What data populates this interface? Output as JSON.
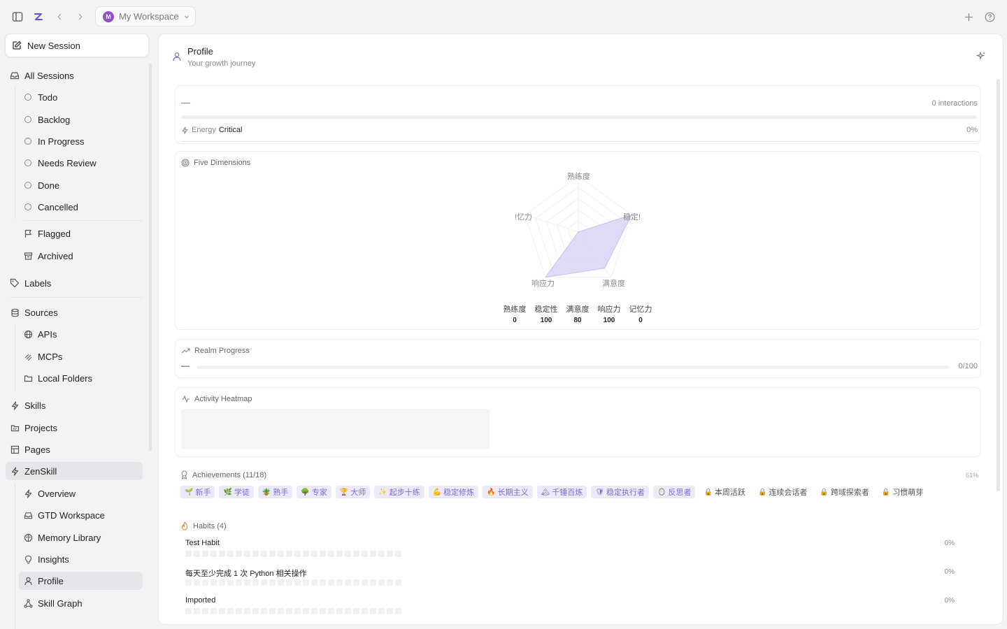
{
  "topbar": {
    "workspace_initial": "M",
    "workspace_name": "My Workspace"
  },
  "sidebar": {
    "new_session": "New Session",
    "all_sessions": "All Sessions",
    "statuses": [
      "Todo",
      "Backlog",
      "In Progress",
      "Needs Review",
      "Done",
      "Cancelled"
    ],
    "flagged": "Flagged",
    "archived": "Archived",
    "labels": "Labels",
    "sources": "Sources",
    "source_items": [
      "APIs",
      "MCPs",
      "Local Folders"
    ],
    "skills": "Skills",
    "projects": "Projects",
    "pages": "Pages",
    "zenskill": "ZenSkill",
    "zenskill_items": [
      "Overview",
      "GTD Workspace",
      "Memory Library",
      "Insights",
      "Profile",
      "Skill Graph"
    ]
  },
  "header": {
    "title": "Profile",
    "subtitle": "Your growth journey"
  },
  "level": {
    "name": "—",
    "interactions": "0 interactions",
    "energy_label": "Energy",
    "energy_value": "Critical",
    "energy_pct": "0%",
    "energy_fraction": 0
  },
  "dimensions": {
    "title": "Five Dimensions",
    "axes": [
      "熟练度",
      "稳定性",
      "满意度",
      "响应力",
      "记忆力"
    ],
    "axis_values": [
      0,
      100,
      80,
      100,
      0
    ],
    "axis_label_text": [
      "熟练度",
      "稳定!",
      "满意度",
      "响应力",
      "!忆力"
    ]
  },
  "realm": {
    "title": "Realm Progress",
    "name": "—",
    "value": "0/100",
    "fraction": 0
  },
  "heatmap": {
    "title": "Activity Heatmap"
  },
  "achievements": {
    "title": "Achievements (11/18)",
    "percent": "61%",
    "items": [
      {
        "icon": "🌱",
        "label": "新手",
        "unlocked": true
      },
      {
        "icon": "🌿",
        "label": "学徒",
        "unlocked": true
      },
      {
        "icon": "🪴",
        "label": "熟手",
        "unlocked": true
      },
      {
        "icon": "🌳",
        "label": "专家",
        "unlocked": true
      },
      {
        "icon": "🏆",
        "label": "大师",
        "unlocked": true
      },
      {
        "icon": "✨",
        "label": "起步十练",
        "unlocked": true
      },
      {
        "icon": "💪",
        "label": "稳定修炼",
        "unlocked": true
      },
      {
        "icon": "🔥",
        "label": "长期主义",
        "unlocked": true
      },
      {
        "icon": "🏔",
        "label": "千锤百炼",
        "unlocked": true
      },
      {
        "icon": "🛡",
        "label": "稳定执行者",
        "unlocked": true
      },
      {
        "icon": "🪞",
        "label": "反思者",
        "unlocked": true
      },
      {
        "icon": "🔒",
        "label": "本周活跃",
        "unlocked": false
      },
      {
        "icon": "🔒",
        "label": "连续会话者",
        "unlocked": false
      },
      {
        "icon": "🔒",
        "label": "跨域探索者",
        "unlocked": false
      },
      {
        "icon": "🔒",
        "label": "习惯萌芽",
        "unlocked": false
      }
    ]
  },
  "habits": {
    "title": "Habits (4)",
    "items": [
      {
        "name": "Test Habit",
        "pct": "0%"
      },
      {
        "name": "每天至少完成 1 次 Python 相关操作",
        "pct": "0%"
      },
      {
        "name": "Imported",
        "pct": "0%"
      }
    ]
  }
}
